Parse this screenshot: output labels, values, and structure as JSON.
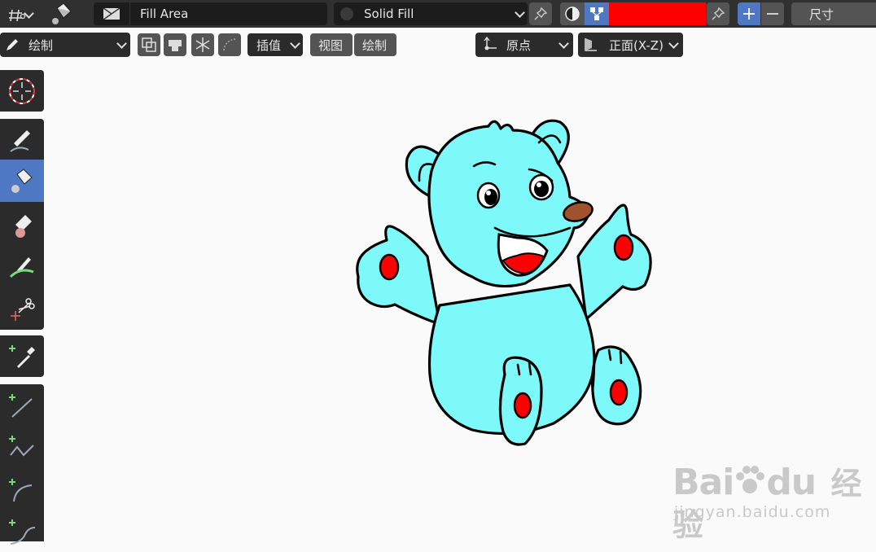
{
  "header": {
    "fill_name": "Fill Area",
    "fill_style": "Solid Fill",
    "color_swatch": "#ff0000",
    "size_label": "尺寸"
  },
  "toolbar2": {
    "mode_label": "绘制",
    "interpolate_label": "插值",
    "view_label": "视图",
    "draw_label": "绘制",
    "origin_label": "原点",
    "view_plane_label": "正面(X-Z)"
  },
  "tools": [
    "cursor-icon",
    "draw-icon",
    "fill-icon",
    "erase-icon",
    "tint-icon",
    "cutter-icon",
    "eyedropper-icon",
    "line-icon",
    "polyline-icon",
    "arc-icon",
    "curve-icon"
  ],
  "canvas": {
    "subject": "cyan cartoon bear",
    "fill_color": "#7ef9f9",
    "accent_color": "#ff0000"
  },
  "watermark": {
    "brand_a": "Bai",
    "brand_b": "du",
    "brand_cn": "经验",
    "url": "jingyan.baidu.com"
  }
}
